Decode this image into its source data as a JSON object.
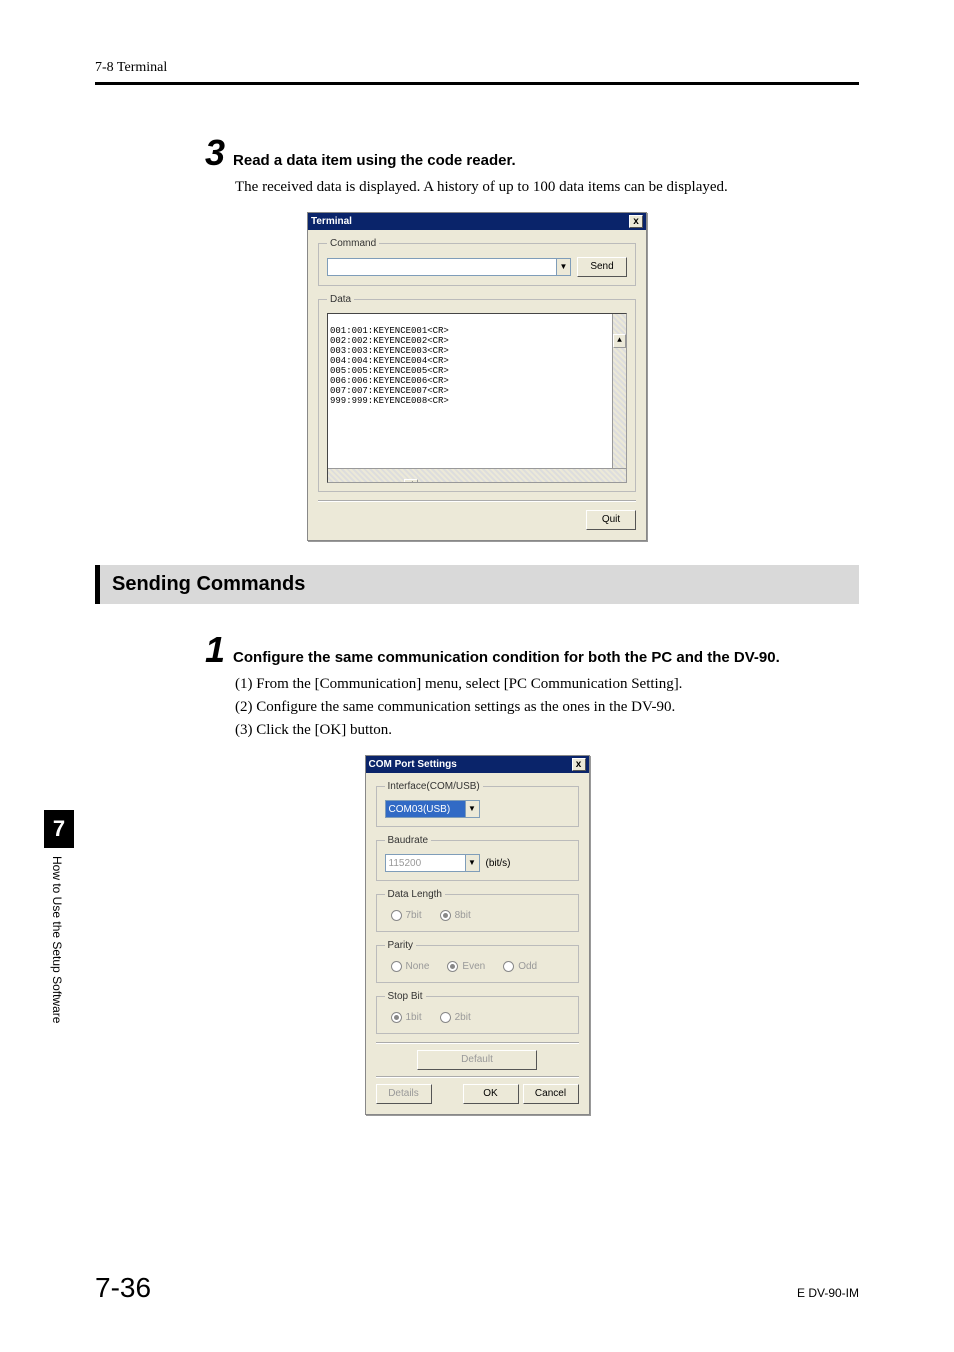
{
  "header": {
    "left": "7-8  Terminal"
  },
  "step3": {
    "num": "3",
    "title": "Read a data item using the code reader.",
    "body": "The received data is displayed. A history of up to 100 data items can be displayed."
  },
  "terminal_dialog": {
    "title": "Terminal",
    "close": "x",
    "command_legend": "Command",
    "send": "Send",
    "data_legend": "Data",
    "lines": "001:001:KEYENCE001<CR>\n002:002:KEYENCE002<CR>\n003:003:KEYENCE003<CR>\n004:004:KEYENCE004<CR>\n005:005:KEYENCE005<CR>\n006:006:KEYENCE006<CR>\n007:007:KEYENCE007<CR>\n999:999:KEYENCE008<CR>",
    "quit": "Quit"
  },
  "section": {
    "title": "Sending Commands"
  },
  "step1": {
    "num": "1",
    "title": "Configure the same communication condition for both the PC and the DV-90.",
    "l1": "(1) From the [Communication] menu, select [PC Communication Setting].",
    "l2": "(2) Configure the same communication settings as the ones in the DV-90.",
    "l3": "(3) Click the [OK] button."
  },
  "com_dialog": {
    "title": "COM Port Settings",
    "close": "x",
    "interface_legend": "Interface(COM/USB)",
    "interface_value": "COM03(USB)",
    "baud_legend": "Baudrate",
    "baud_value": "115200",
    "baud_unit": "(bit/s)",
    "datalen_legend": "Data Length",
    "datalen_7": "7bit",
    "datalen_8": "8bit",
    "parity_legend": "Parity",
    "parity_none": "None",
    "parity_even": "Even",
    "parity_odd": "Odd",
    "stop_legend": "Stop Bit",
    "stop_1": "1bit",
    "stop_2": "2bit",
    "default": "Default",
    "details": "Details",
    "ok": "OK",
    "cancel": "Cancel"
  },
  "side": {
    "chapter": "7",
    "caption": "How to Use the Setup Software"
  },
  "footer": {
    "page": "7-36",
    "docid": "E DV-90-IM"
  }
}
